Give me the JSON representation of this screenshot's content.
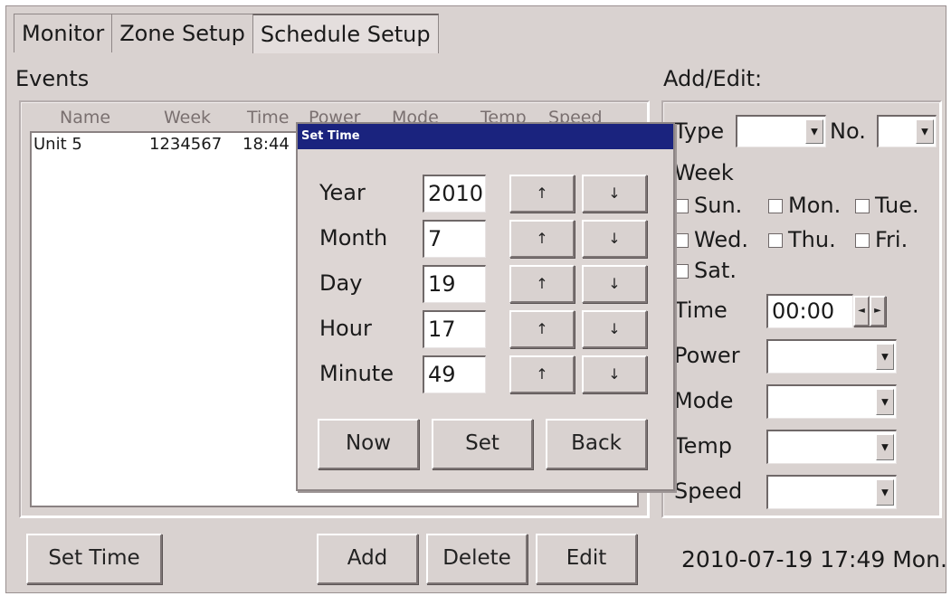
{
  "tabs": [
    {
      "label": "Monitor"
    },
    {
      "label": "Zone Setup"
    },
    {
      "label": "Schedule Setup"
    }
  ],
  "events": {
    "title": "Events",
    "columns": [
      "Name",
      "Week",
      "Time",
      "Power",
      "Mode",
      "Temp",
      "Speed"
    ],
    "rows": [
      {
        "name": "Unit 5",
        "week": "1234567",
        "time": "18:44"
      }
    ]
  },
  "add_edit": {
    "title": "Add/Edit:",
    "type_label": "Type",
    "no_label": "No.",
    "week_label": "Week",
    "days": [
      "Sun.",
      "Mon.",
      "Tue.",
      "Wed.",
      "Thu.",
      "Fri.",
      "Sat."
    ],
    "time_label": "Time",
    "time_value": "00:00",
    "power_label": "Power",
    "mode_label": "Mode",
    "temp_label": "Temp",
    "speed_label": "Speed"
  },
  "dialog": {
    "title": "Set Time",
    "fields": [
      {
        "label": "Year",
        "value": "2010"
      },
      {
        "label": "Month",
        "value": "7"
      },
      {
        "label": "Day",
        "value": "19"
      },
      {
        "label": "Hour",
        "value": "17"
      },
      {
        "label": "Minute",
        "value": "49"
      }
    ],
    "up_glyph": "↑",
    "down_glyph": "↓",
    "now_label": "Now",
    "set_label": "Set",
    "back_label": "Back"
  },
  "bottom": {
    "set_time_label": "Set Time",
    "add_label": "Add",
    "delete_label": "Delete",
    "edit_label": "Edit",
    "datetime": "2010-07-19 17:49 Mon."
  },
  "colors": {
    "panel": "#d9d2d0",
    "titlebar": "#1a237e"
  }
}
